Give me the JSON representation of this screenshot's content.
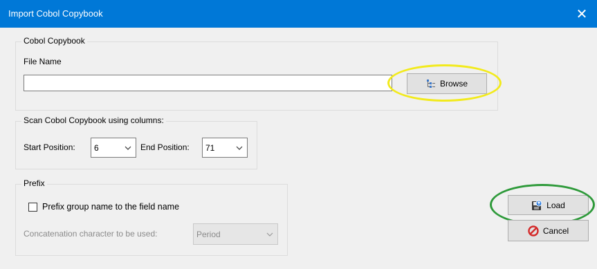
{
  "window": {
    "title": "Import Cobol Copybook",
    "close_glyph": "✕"
  },
  "copybook_group": {
    "legend": "Cobol Copybook",
    "file_name_label": "File Name",
    "file_name_value": "",
    "browse_label": "Browse",
    "browse_icon": "tree-list-icon"
  },
  "scan_group": {
    "legend": "Scan Cobol Copybook using columns:",
    "start_label": "Start Position:",
    "start_value": "6",
    "end_label": "End Position:",
    "end_value": "71"
  },
  "prefix_group": {
    "legend": "Prefix",
    "checkbox_label": "Prefix group name to the field name",
    "checkbox_checked": false,
    "concat_label": "Concatenation character to be used:",
    "concat_value": "Period"
  },
  "actions": {
    "load_label": "Load",
    "load_icon": "load-disk-icon",
    "cancel_label": "Cancel",
    "cancel_icon": "cancel-circle-icon"
  },
  "annotations": {
    "browse_highlight_color": "#f2ea1c",
    "load_highlight_color": "#2e9a3a"
  }
}
